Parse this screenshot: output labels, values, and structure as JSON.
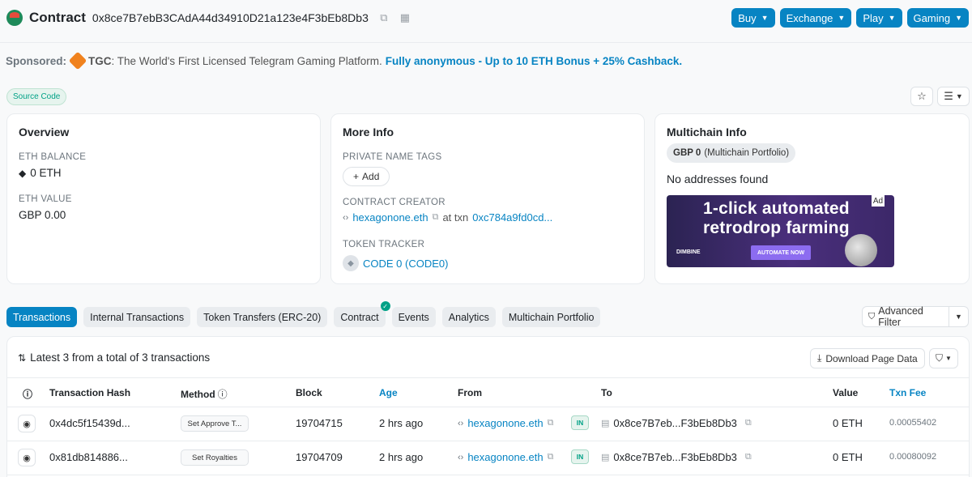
{
  "header": {
    "title": "Contract",
    "address": "0x8ce7B7ebB3CAdA44d34910D21a123e4F3bEb8Db3",
    "menu_buttons": [
      "Buy",
      "Exchange",
      "Play",
      "Gaming"
    ]
  },
  "sponsored": {
    "label": "Sponsored:",
    "name": "TGC",
    "text": ": The World's First Licensed Telegram Gaming Platform.",
    "highlight": "Fully anonymous - Up to 10 ETH Bonus + 25% Cashback."
  },
  "source_code_label": "Source Code",
  "overview": {
    "title": "Overview",
    "eth_balance_label": "ETH BALANCE",
    "eth_balance_value": "0 ETH",
    "eth_value_label": "ETH VALUE",
    "eth_value_value": "GBP 0.00"
  },
  "more_info": {
    "title": "More Info",
    "private_tags_label": "PRIVATE NAME TAGS",
    "add_label": "Add",
    "creator_label": "CONTRACT CREATOR",
    "creator_name": "hexagonone.eth",
    "at_txn": "at txn",
    "creator_txn": "0xc784a9fd0cd...",
    "token_tracker_label": "TOKEN TRACKER",
    "token_tracker_value": "CODE 0 (CODE0)"
  },
  "multichain": {
    "title": "Multichain Info",
    "chip_bold": "GBP 0",
    "chip_text": "(Multichain Portfolio)",
    "no_addresses": "No addresses found",
    "ad_line1": "1-click automated",
    "ad_line2": "retrodrop farming",
    "ad_cta": "AUTOMATE NOW",
    "ad_brand": "DIMBINE",
    "ad_tag": "Ad"
  },
  "tabs": [
    "Transactions",
    "Internal Transactions",
    "Token Transfers (ERC-20)",
    "Contract",
    "Events",
    "Analytics",
    "Multichain Portfolio"
  ],
  "advanced_filter_label": "Advanced Filter",
  "transactions": {
    "summary": "Latest 3 from a total of 3 transactions",
    "download_label": "Download Page Data",
    "columns": {
      "hash": "Transaction Hash",
      "method": "Method",
      "block": "Block",
      "age": "Age",
      "from": "From",
      "to": "To",
      "value": "Value",
      "fee": "Txn Fee"
    },
    "rows": [
      {
        "hash": "0x4dc5f15439d...",
        "method": "Set Approve T...",
        "block": "19704715",
        "age": "2 hrs ago",
        "from": "hexagonone.eth",
        "direction": "IN",
        "to": "0x8ce7B7eb...F3bEb8Db3",
        "value": "0 ETH",
        "fee": "0.00055402"
      },
      {
        "hash": "0x81db814886...",
        "method": "Set Royalties",
        "block": "19704709",
        "age": "2 hrs ago",
        "from": "hexagonone.eth",
        "direction": "IN",
        "to": "0x8ce7B7eb...F3bEb8Db3",
        "value": "0 ETH",
        "fee": "0.00080092"
      }
    ]
  },
  "colors": {
    "accent": "#0784c3",
    "success": "#00a186"
  }
}
